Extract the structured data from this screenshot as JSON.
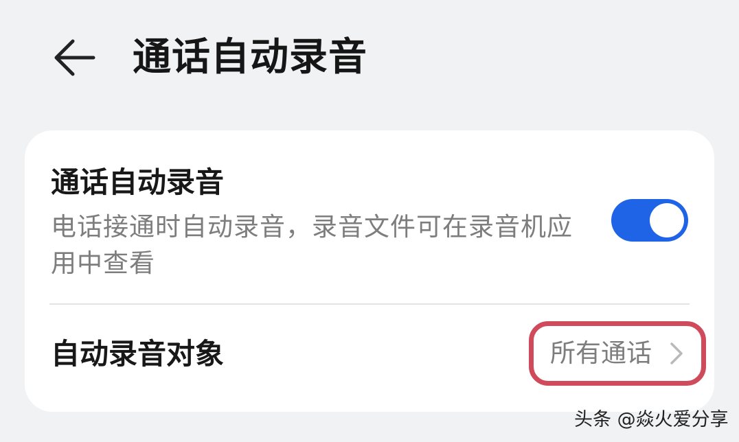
{
  "header": {
    "title": "通话自动录音"
  },
  "auto_record": {
    "title": "通话自动录音",
    "description": "电话接通时自动录音，录音文件可在录音机应用中查看",
    "enabled": true
  },
  "target": {
    "label": "自动录音对象",
    "value": "所有通话"
  },
  "watermark": {
    "text": "头条 @焱火爱分享"
  },
  "colors": {
    "background": "#f1f2f4",
    "toggle_on": "#1f64e6",
    "highlight_border": "#cf4a5a",
    "secondary_text": "#7d7d7d"
  },
  "icons": {
    "back": "arrow-left-icon",
    "chevron": "chevron-right-icon"
  }
}
